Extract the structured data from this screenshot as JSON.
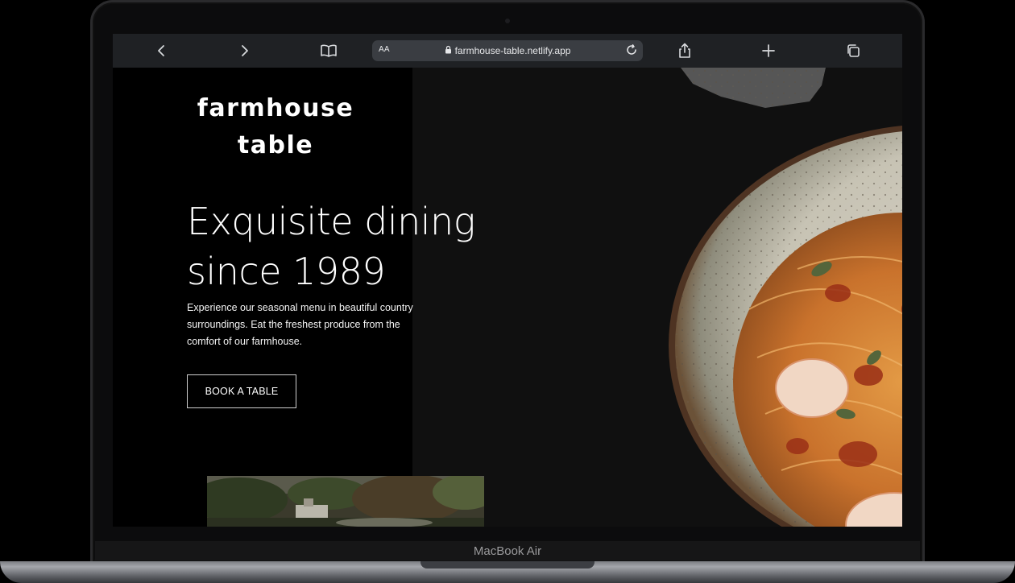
{
  "device": {
    "model_label": "MacBook Air"
  },
  "browser": {
    "text_size_label": "AA",
    "url": "farmhouse-table.netlify.app",
    "icons": [
      "chevron-left-icon",
      "chevron-right-icon",
      "book-icon",
      "lock-icon",
      "reload-icon",
      "share-icon",
      "plus-icon",
      "tabs-icon"
    ]
  },
  "site": {
    "logo_line1": "farmhouse",
    "logo_line2": "table",
    "headline_line1": "Exquisite dining",
    "headline_line2": "since 1989",
    "description": "Experience our seasonal menu in beautiful country surroundings. Eat the freshest produce from the comfort of our farmhouse.",
    "cta_label": "BOOK A TABLE"
  },
  "colors": {
    "page_background": "#000000",
    "image_panel_background": "#101010",
    "toolbar": "#1f2124",
    "address_bar": "#3a3d42",
    "text": "#ffffff"
  }
}
